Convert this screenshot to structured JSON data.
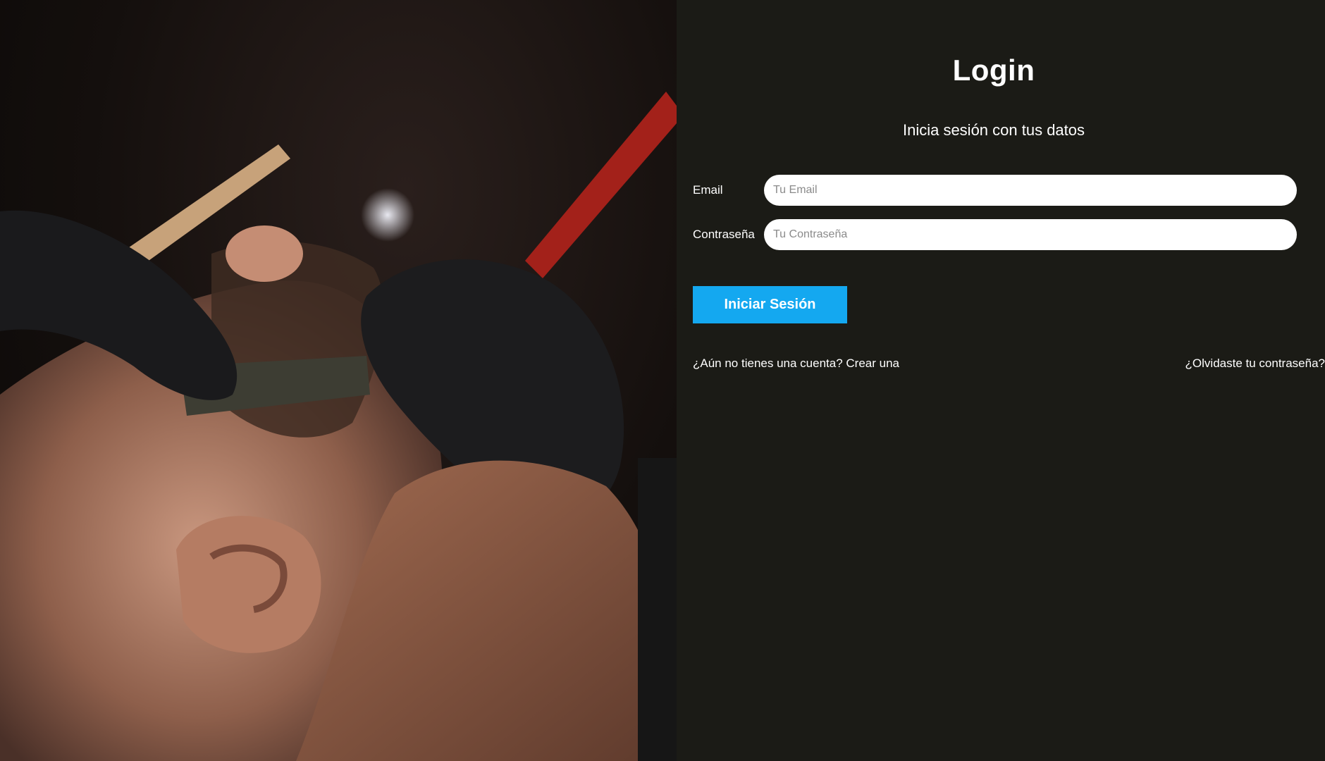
{
  "hero": {
    "image_subject": "barber-shaving-beard-photo"
  },
  "login": {
    "title": "Login",
    "subtitle": "Inicia sesión con tus datos",
    "email_label": "Email",
    "email_placeholder": "Tu Email",
    "email_value": "",
    "password_label": "Contraseña",
    "password_placeholder": "Tu Contraseña",
    "password_value": "",
    "submit_label": "Iniciar Sesión",
    "register_link": "¿Aún no tienes una cuenta? Crear una",
    "forgot_link": "¿Olvidaste tu contraseña?"
  },
  "colors": {
    "panel_background": "#1b1b16",
    "accent": "#14a8f0",
    "text": "#ffffff",
    "input_background": "#ffffff"
  }
}
